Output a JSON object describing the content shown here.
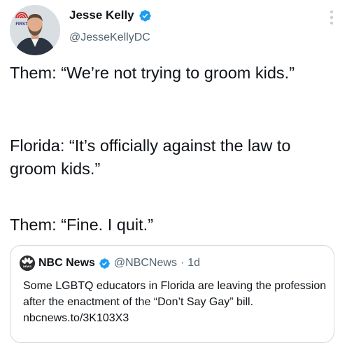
{
  "author": {
    "display_name": "Jesse Kelly",
    "handle": "@JesseKellyDC",
    "avatar_badge_text": "FIRST"
  },
  "tweet": {
    "line1": "Them: “We’re not trying to groom kids.”",
    "line2": "Florida: “It’s officially against the law to groom kids.”",
    "line3": "Them: “Fine. I quit.”"
  },
  "quoted": {
    "name": "NBC News",
    "handle": "@NBCNews",
    "separator": "·",
    "time": "1d",
    "text": "Some LGBTQ educators in Florida are leaving the profession after the enactment of the “Don’t Say Gay” bill. nbcnews.to/3K103X3"
  },
  "icons": {
    "verified": "verified-badge-icon",
    "more": "more-options-icon",
    "nbc_logo": "peacock-logo-icon"
  },
  "colors": {
    "verified_blue": "#1d9bf0",
    "secondary_text": "#536471",
    "border": "#cfd9de"
  }
}
